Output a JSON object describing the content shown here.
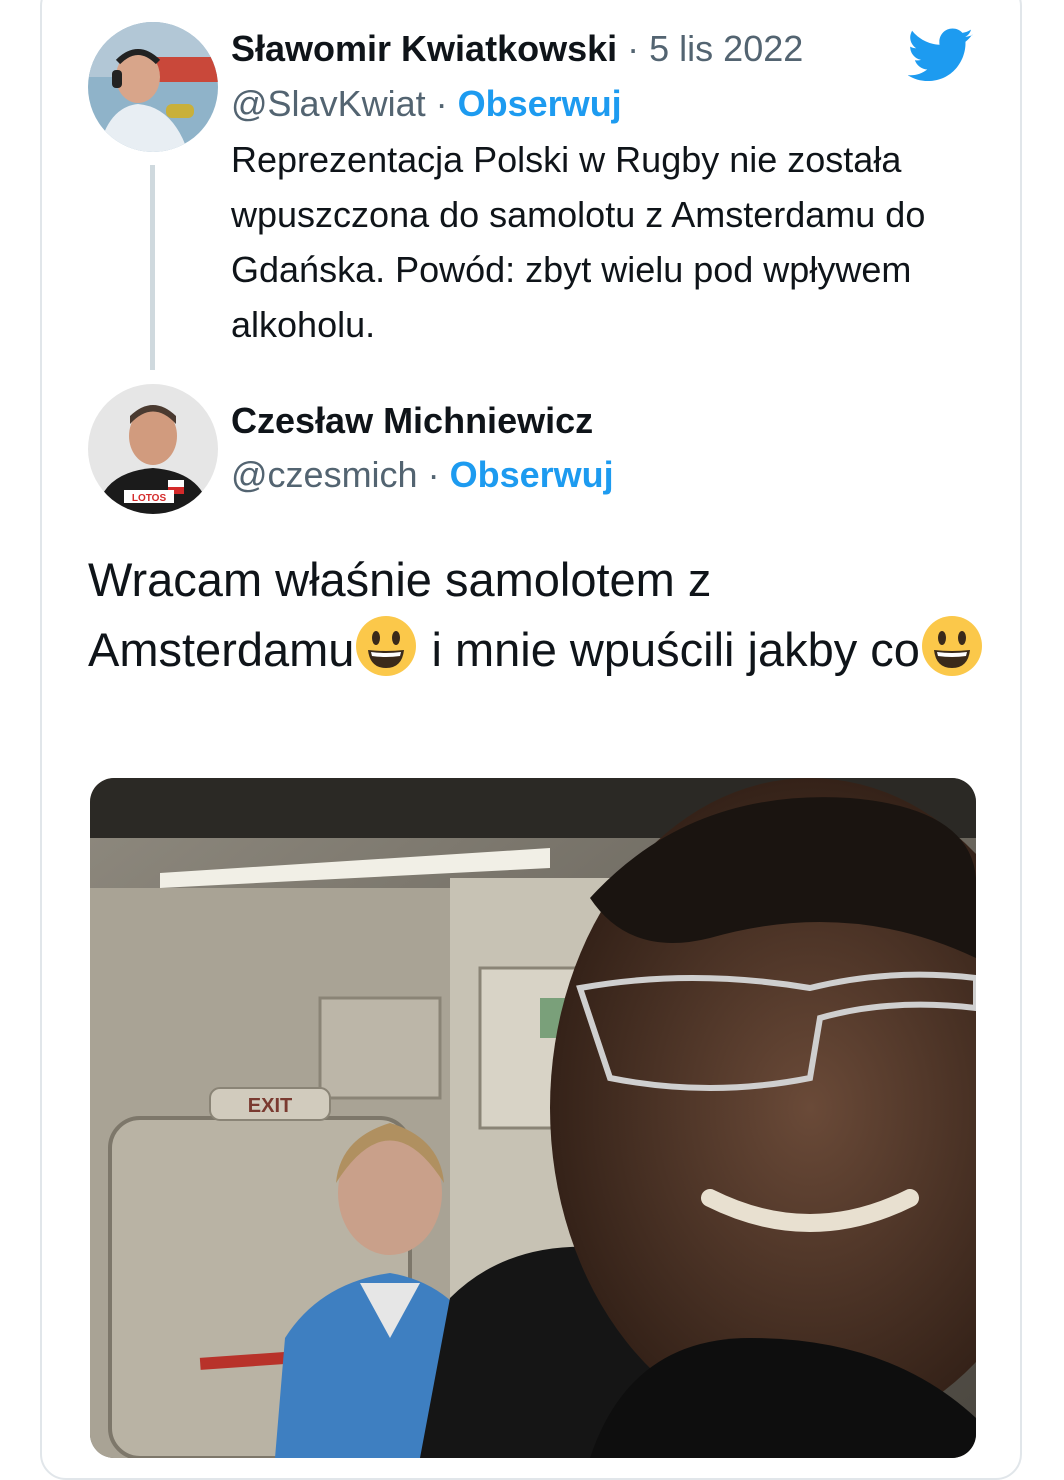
{
  "original_tweet": {
    "author_name": "Sławomir Kwiatkowski",
    "separator": "·",
    "date": "5 lis 2022",
    "handle": "@SlavKwiat",
    "follow_label": "Obserwuj",
    "text": "Reprezentacja Polski w Rugby nie została wpuszczona do samolotu z Amsterdamu do Gdańska. Powód: zbyt wielu pod wpływem alkoholu."
  },
  "reply_tweet": {
    "author_name": "Czesław Michniewicz",
    "separator": "·",
    "handle": "@czesmich",
    "follow_label": "Obserwuj",
    "text_part1": "Wracam  właśnie samolotem z Amsterdamu",
    "text_part2": " i mnie wpuścili jakby co",
    "emoji": "grinning-face",
    "avatar_shirt_logo": "LOTOS",
    "photo_sign": "EXIT"
  },
  "icons": {
    "platform": "twitter-bird-icon"
  },
  "colors": {
    "link_blue": "#1d9bf0",
    "muted_gray": "#536471",
    "text_dark": "#0f1419",
    "thread_line": "#cfd9de"
  }
}
